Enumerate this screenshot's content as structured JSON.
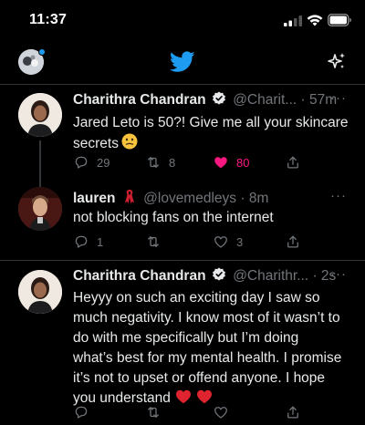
{
  "status_bar": {
    "time": "11:37"
  },
  "tweets": [
    {
      "name": "Charithra Chandran",
      "handle": "@Charit...",
      "time": "57m",
      "more": "···",
      "lines": [
        "Jared Leto is 50?! Give me all your skincare",
        "secrets"
      ],
      "replies": "29",
      "retweets": "8",
      "likes": "80"
    },
    {
      "name": "lauren",
      "handle": "@lovemedleys",
      "time": "8m",
      "more": "···",
      "lines": [
        "not blocking fans on the internet"
      ],
      "replies": "1",
      "retweets": "",
      "likes": "3"
    },
    {
      "name": "Charithra Chandran",
      "handle": "@Charithr...",
      "time": "2s",
      "more": "···",
      "lines": [
        "Heyyy on such an exciting day I saw so",
        "much negativity. I know most of it wasn’t to",
        "do with me specifically but I’m doing",
        "what’s best for my mental health. I promise",
        "it’s not to upset or offend anyone. I hope",
        "you understand"
      ],
      "replies": "",
      "retweets": "",
      "likes": ""
    }
  ],
  "separator": "·",
  "colors": {
    "accent": "#1d9bf0",
    "like": "#f91880",
    "muted": "#71767b"
  }
}
